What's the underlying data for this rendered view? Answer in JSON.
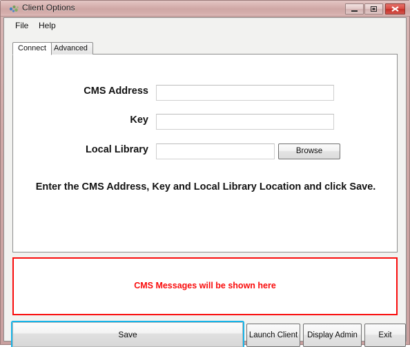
{
  "window": {
    "title": "Client Options",
    "icon": "app-icon",
    "controls": {
      "minimize": "minimize-icon",
      "maximize": "maximize-icon",
      "close": "close-icon"
    }
  },
  "menubar": {
    "items": [
      {
        "label": "File"
      },
      {
        "label": "Help"
      }
    ]
  },
  "tabs": [
    {
      "label": "Connect",
      "active": true
    },
    {
      "label": "Advanced",
      "active": false
    }
  ],
  "form": {
    "fields": [
      {
        "label": "CMS Address",
        "value": "",
        "placeholder": ""
      },
      {
        "label": "Key",
        "value": "",
        "placeholder": ""
      },
      {
        "label": "Local Library",
        "value": "",
        "placeholder": ""
      }
    ],
    "browse_label": "Browse",
    "hint": "Enter the CMS Address, Key and Local Library Location and click Save."
  },
  "messages": {
    "text": "CMS Messages will be shown here",
    "color": "#f90b0b"
  },
  "actions": {
    "save_label": "Save",
    "launch_label": "Launch Client",
    "admin_label": "Display Admin",
    "exit_label": "Exit",
    "focus_color": "#17b4e8"
  }
}
